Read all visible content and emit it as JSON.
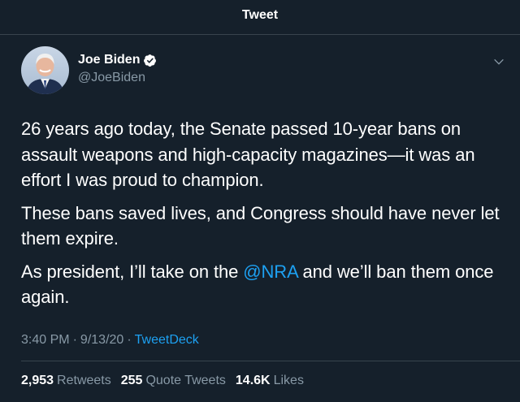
{
  "header": {
    "title": "Tweet"
  },
  "author": {
    "display_name": "Joe Biden",
    "handle": "@JoeBiden",
    "verified": true
  },
  "tweet": {
    "paragraph1": "26 years ago today, the Senate passed 10-year bans on assault weapons and high-capacity magazines—it was an effort I was proud to champion.",
    "paragraph2": "These bans saved lives, and Congress should have never let them expire.",
    "paragraph3_before": "As president, I’ll take on the ",
    "paragraph3_mention": "@NRA",
    "paragraph3_after": " and we’ll ban them once again."
  },
  "meta": {
    "time": "3:40 PM",
    "dot1": "·",
    "date": "9/13/20",
    "dot2": "·",
    "source": "TweetDeck"
  },
  "stats": {
    "retweets_count": "2,953",
    "retweets_label": "Retweets",
    "quotes_count": "255",
    "quotes_label": "Quote Tweets",
    "likes_count": "14.6K",
    "likes_label": "Likes"
  },
  "colors": {
    "background": "#15202b",
    "accent": "#1da1f2",
    "secondary_text": "#8899a6",
    "border": "#38444d"
  },
  "icons": {
    "verified": "verified-badge-icon",
    "caret": "chevron-down-icon"
  }
}
